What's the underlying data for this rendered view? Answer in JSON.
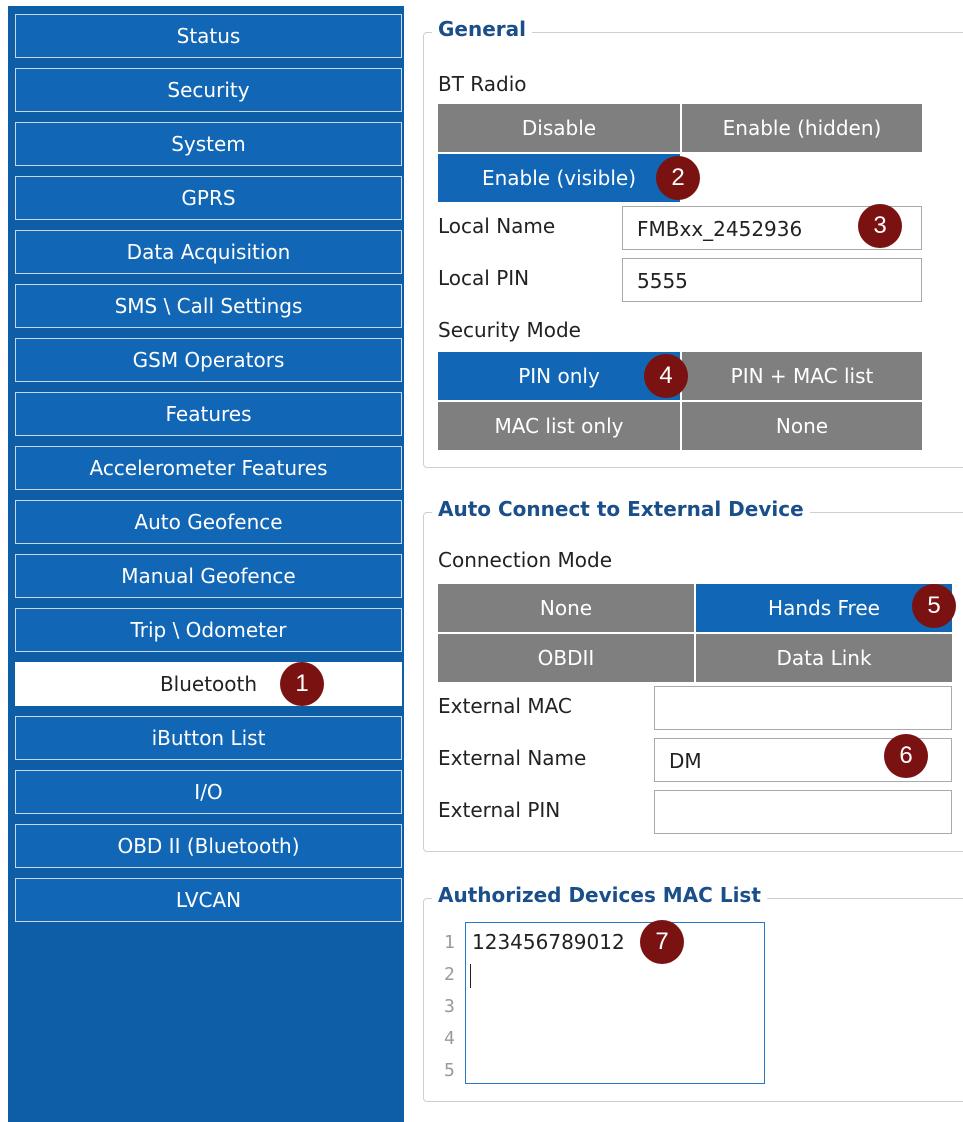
{
  "sidebar": {
    "items": [
      {
        "label": "Status"
      },
      {
        "label": "Security"
      },
      {
        "label": "System"
      },
      {
        "label": "GPRS"
      },
      {
        "label": "Data Acquisition"
      },
      {
        "label": "SMS \\ Call Settings"
      },
      {
        "label": "GSM Operators"
      },
      {
        "label": "Features"
      },
      {
        "label": "Accelerometer Features"
      },
      {
        "label": "Auto Geofence"
      },
      {
        "label": "Manual Geofence"
      },
      {
        "label": "Trip \\ Odometer"
      },
      {
        "label": "Bluetooth"
      },
      {
        "label": "iButton List"
      },
      {
        "label": "I/O"
      },
      {
        "label": "OBD II (Bluetooth)"
      },
      {
        "label": "LVCAN"
      }
    ],
    "active_index": 12
  },
  "general": {
    "title": "General",
    "bt_radio": {
      "label": "BT Radio",
      "options": [
        "Disable",
        "Enable (hidden)",
        "Enable (visible)"
      ],
      "selected": "Enable (visible)"
    },
    "local_name": {
      "label": "Local Name",
      "value": "FMBxx_2452936"
    },
    "local_pin": {
      "label": "Local PIN",
      "value": "5555"
    },
    "security_mode": {
      "label": "Security Mode",
      "options": [
        "PIN only",
        "PIN + MAC list",
        "MAC list only",
        "None"
      ],
      "selected": "PIN only"
    }
  },
  "auto_connect": {
    "title": "Auto Connect to External Device",
    "connection_mode": {
      "label": "Connection Mode",
      "options": [
        "None",
        "Hands Free",
        "OBDII",
        "Data Link"
      ],
      "selected": "Hands Free"
    },
    "external_mac": {
      "label": "External MAC",
      "value": ""
    },
    "external_name": {
      "label": "External Name",
      "value": "DM"
    },
    "external_pin": {
      "label": "External PIN",
      "value": ""
    }
  },
  "mac_list": {
    "title": "Authorized Devices MAC List",
    "line_numbers": [
      "1",
      "2",
      "3",
      "4",
      "5"
    ],
    "lines": [
      "123456789012",
      ""
    ]
  },
  "badges": [
    "1",
    "2",
    "3",
    "4",
    "5",
    "6",
    "7"
  ],
  "colors": {
    "sidebar_bg": "#0d5ea6",
    "accent_blue": "#1167b5",
    "segment_gray": "#7f7f7f",
    "badge_red": "#7b1212",
    "title_blue": "#1b4f8a"
  }
}
